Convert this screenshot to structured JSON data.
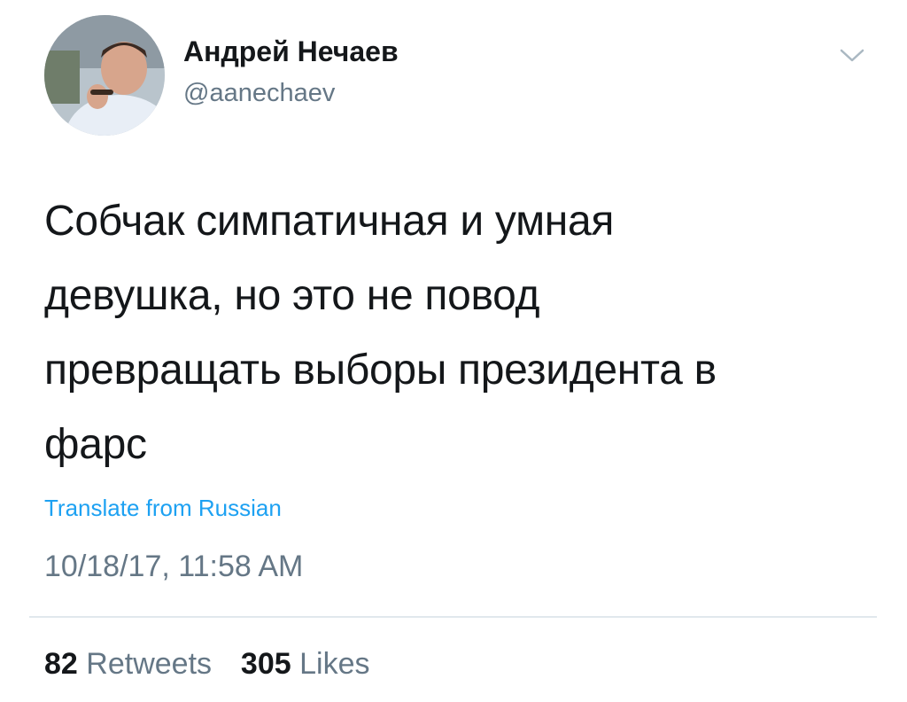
{
  "tweet": {
    "author": {
      "display_name": "Андрей Нечаев",
      "handle": "@aanechaev"
    },
    "text_lines": [
      "Собчак симпатичная и умная",
      "девушка, но это не повод",
      "превращать выборы президента в",
      "фарс"
    ],
    "translate_label": "Translate from Russian",
    "timestamp": "10/18/17, 11:58 AM",
    "stats": {
      "retweets_count": "82",
      "retweets_label": "Retweets",
      "likes_count": "305",
      "likes_label": "Likes"
    }
  },
  "icons": {
    "menu": "chevron-down-icon"
  },
  "colors": {
    "link": "#1da1f2",
    "secondary_text": "#657786",
    "primary_text": "#14171a",
    "divider": "#e1e8ed"
  }
}
